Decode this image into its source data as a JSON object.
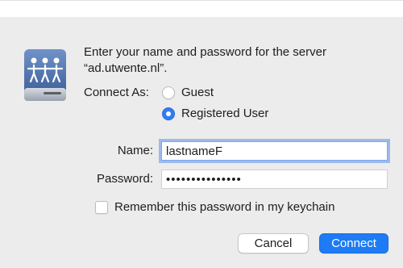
{
  "dialog": {
    "prompt_line1": "Enter your name and password for the server",
    "prompt_line2": "“ad.utwente.nl”.",
    "icon": "network-server-icon"
  },
  "connect_as": {
    "label": "Connect As:",
    "options": [
      {
        "label": "Guest",
        "selected": false
      },
      {
        "label": "Registered User",
        "selected": true
      }
    ]
  },
  "fields": {
    "name_label": "Name:",
    "name_value": "lastnameF",
    "password_label": "Password:",
    "password_value": "•••••••••••••••"
  },
  "remember": {
    "label": "Remember this password in my keychain",
    "checked": false
  },
  "buttons": {
    "cancel_label": "Cancel",
    "connect_label": "Connect"
  },
  "colors": {
    "accent": "#1e7bf4",
    "background": "#ececec",
    "icon_blue": "#4b6fa6"
  }
}
